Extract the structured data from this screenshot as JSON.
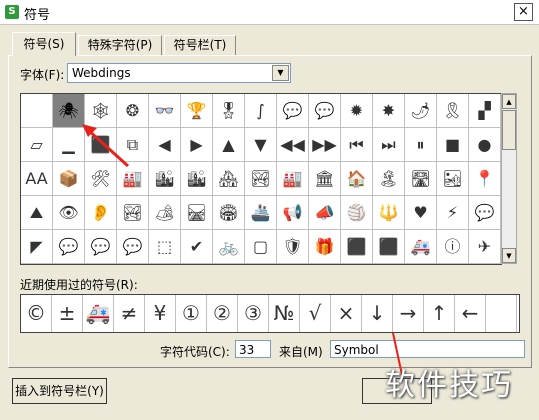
{
  "window": {
    "title": "符号",
    "app_icon_glyph": "S",
    "close_glyph": "×"
  },
  "tabs": [
    {
      "label": "符号(S)"
    },
    {
      "label": "特殊字符(P)"
    },
    {
      "label": "符号栏(T)"
    }
  ],
  "font": {
    "label": "字体(F):",
    "value": "Webdings",
    "arrow": "▼"
  },
  "grid": {
    "selected_index": 1,
    "rows": [
      [
        "",
        "🕷",
        "🕸",
        "❂",
        "👓",
        "🏆",
        "🎖",
        "∫",
        "💬",
        "💬",
        "✹",
        "✸",
        "🌶",
        "🎗",
        "▞"
      ],
      [
        "▱",
        "▁",
        "⬛",
        "⧉",
        "◀",
        "▶",
        "▲",
        "▼",
        "◀◀",
        "▶▶",
        "⏮",
        "⏭",
        "⏸",
        "■",
        "●"
      ],
      [
        "AA",
        "📦",
        "🛠",
        "🏭",
        "🏙",
        "🏙",
        "🏘",
        "🏞",
        "🏭",
        "🏛",
        "🏠",
        "🏝",
        "🛣",
        "🏜",
        "📍"
      ],
      [
        "⛰",
        "👁",
        "👂",
        "🏞",
        "🏕",
        "🛤",
        "🏟",
        "🚢",
        "📢",
        "📣",
        "🏐",
        "🔱",
        "♥",
        "⚡",
        "💬"
      ],
      [
        "◤",
        "💬",
        "💬",
        "💬",
        "⬚",
        "✔",
        "🚲",
        "▢",
        "🛡",
        "🎁",
        "⬛",
        "⬛",
        "🚑",
        "ⓘ",
        "✈"
      ]
    ]
  },
  "recent": {
    "label": "近期使用过的符号(R):",
    "symbols": [
      "©",
      "±",
      "🚑",
      "≠",
      "¥",
      "①",
      "②",
      "③",
      "№",
      "√",
      "×",
      "↓",
      "→",
      "↑",
      "←",
      ""
    ]
  },
  "char_code": {
    "label": "字符代码(C):",
    "value": "33"
  },
  "from": {
    "label": "来自(M)",
    "value": "Symbol"
  },
  "buttons": {
    "insert_to_bar": "插入到符号栏(Y)"
  },
  "scroll": {
    "up": "▲",
    "down": "▼"
  },
  "watermark": "软件技巧",
  "colors": {
    "annotation_arrow": "#e8221b",
    "selected_cell": "#808080"
  }
}
